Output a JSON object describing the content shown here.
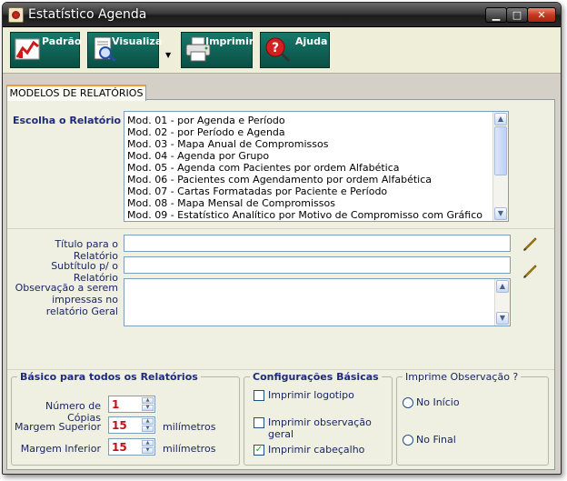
{
  "window": {
    "title": "Estatístico Agenda",
    "controls": {
      "minimize": "▁",
      "maximize": "□",
      "close": "✕"
    }
  },
  "toolbar": {
    "buttons": [
      {
        "label": "Padrão",
        "icon": "red-chart-icon"
      },
      {
        "label": "Visualiza",
        "icon": "document-preview-icon"
      },
      {
        "label": "Imprimir",
        "icon": "printer-icon"
      },
      {
        "label": "Ajuda",
        "icon": "help-magnifier-icon"
      }
    ],
    "dropdown_arrow": "▼"
  },
  "tabs": [
    {
      "label": "MODELOS DE RELATÓRIOS",
      "active": true
    }
  ],
  "report_select": {
    "label": "Escolha o Relatório",
    "items": [
      "Mod. 01 - por Agenda e Período",
      "Mod. 02 - por Período e Agenda",
      "Mod. 03 - Mapa Anual de Compromissos",
      "Mod. 04 - Agenda por Grupo",
      "Mod. 05 - Agenda com Pacientes por ordem Alfabética",
      "Mod. 06 - Pacientes com Agendamento por ordem Alfabética",
      "Mod. 07 - Cartas Formatadas por Paciente e Período",
      "Mod. 08 - Mapa Mensal de Compromissos",
      "Mod. 09 - Estatístico Analítico por Motivo de Compromisso com Gráfico"
    ]
  },
  "fields": {
    "title_label": "Título para o Relatório",
    "title_value": "",
    "subtitle_label": "Subtítulo p/ o Relatório",
    "subtitle_value": "",
    "observation_label": "Observação a serem impressas no relatório Geral",
    "observation_value": ""
  },
  "basic_all": {
    "title": "Básico para todos os Relatórios",
    "copies_label": "Número de Cópias",
    "copies_value": "1",
    "top_margin_label": "Margem Superior",
    "top_margin_value": "15",
    "bottom_margin_label": "Margem Inferior",
    "bottom_margin_value": "15",
    "unit": "milímetros"
  },
  "basic_config": {
    "title": "Configurações Básicas",
    "options": [
      {
        "label": "Imprimir logotipo",
        "checked": false
      },
      {
        "label": "Imprimir observação geral",
        "checked": false
      },
      {
        "label": "Imprimir cabeçalho",
        "checked": true
      }
    ]
  },
  "print_observation": {
    "title": "Imprime Observação ?",
    "options": [
      {
        "label": "No Início"
      },
      {
        "label": "No Final"
      }
    ]
  },
  "colors": {
    "toolbar_button": "#0a4f45",
    "tab_accent": "#e8a034",
    "label_blue": "#1e2b78",
    "spin_value_red": "#c41010"
  }
}
